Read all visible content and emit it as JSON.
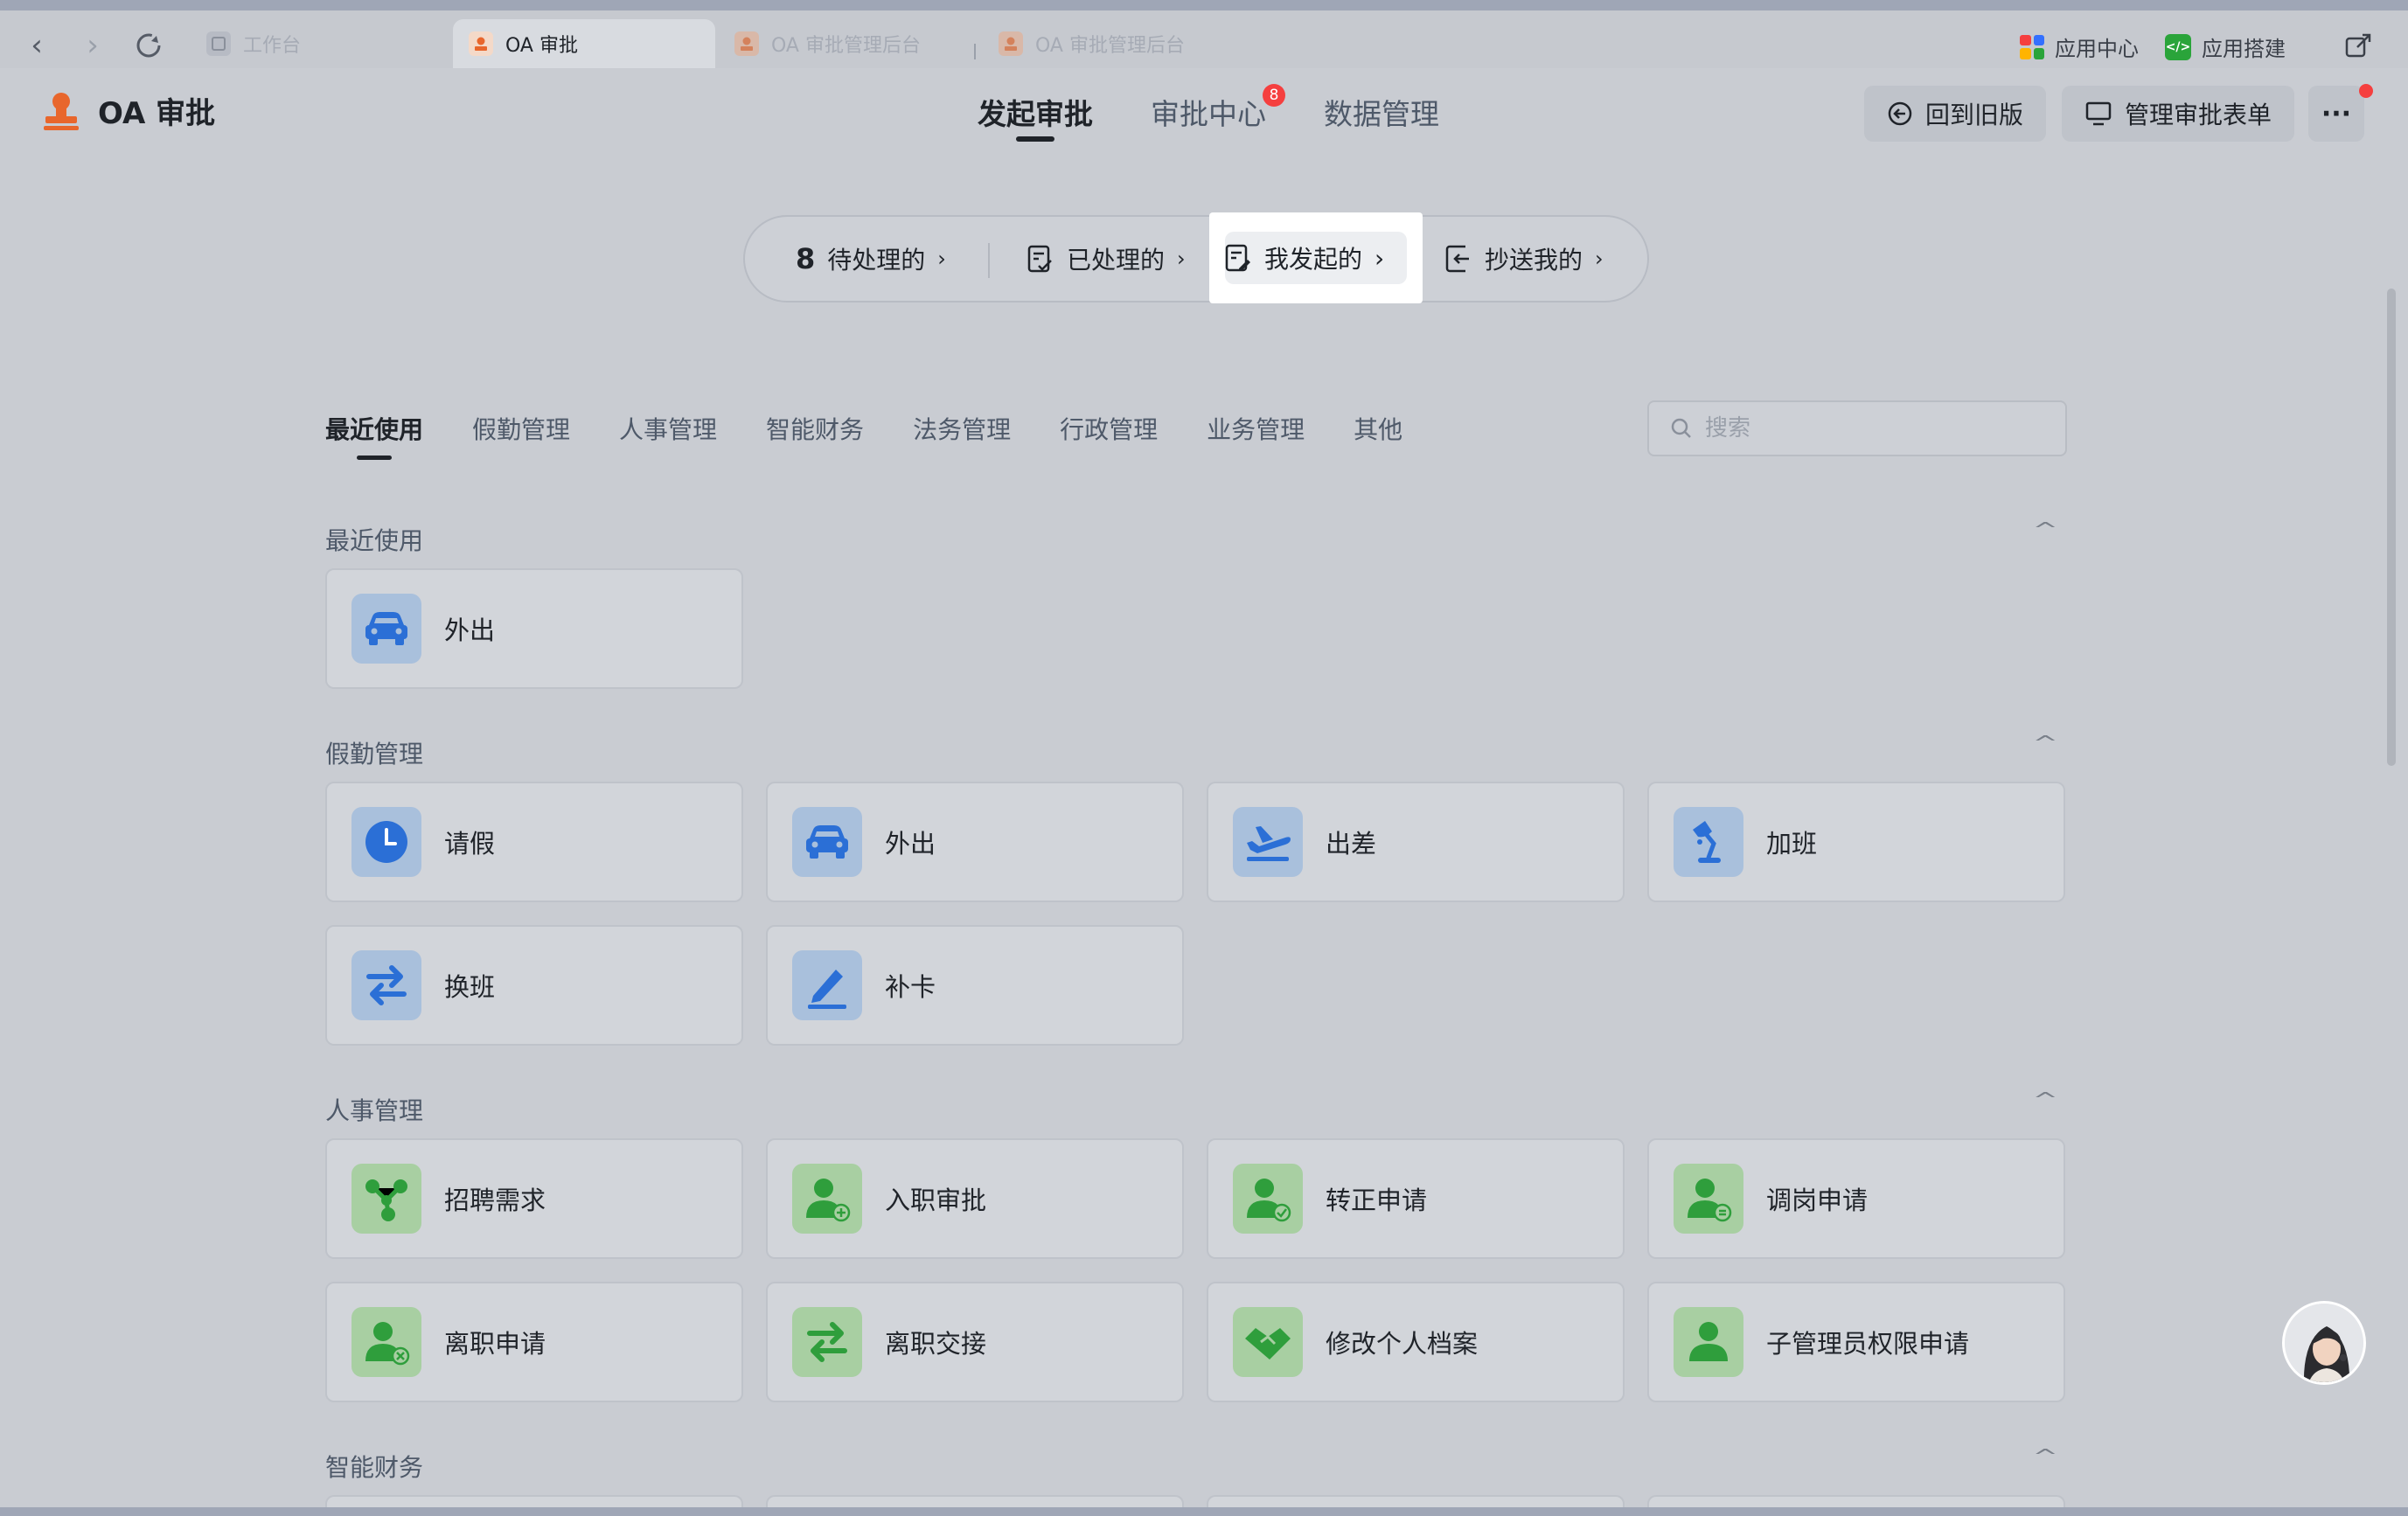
{
  "browser": {
    "tabs": [
      {
        "label": "工作台",
        "active": false
      },
      {
        "label": "OA 审批",
        "active": true
      },
      {
        "label": "OA 审批管理后台",
        "active": false
      },
      {
        "label": "OA 审批管理后台",
        "active": false
      }
    ],
    "app_center": "应用中心",
    "app_builder": "应用搭建"
  },
  "header": {
    "title": "OA 审批",
    "tabs": [
      {
        "label": "发起审批",
        "active": true
      },
      {
        "label": "审批中心",
        "badge": "8"
      },
      {
        "label": "数据管理"
      }
    ],
    "back_old_label": "回到旧版",
    "manage_forms_label": "管理审批表单",
    "more_label": "···"
  },
  "quick_filters": {
    "pending_count": "8",
    "pending_label": "待处理的",
    "processed_label": "已处理的",
    "initiated_label": "我发起的",
    "cc_label": "抄送我的",
    "chevron": "›"
  },
  "categories": [
    "最近使用",
    "假勤管理",
    "人事管理",
    "智能财务",
    "法务管理",
    "行政管理",
    "业务管理",
    "其他"
  ],
  "search": {
    "placeholder": "搜索"
  },
  "sections": {
    "recent": {
      "title": "最近使用",
      "items": [
        "外出"
      ]
    },
    "attendance": {
      "title": "假勤管理",
      "items": [
        "请假",
        "外出",
        "出差",
        "加班",
        "换班",
        "补卡"
      ]
    },
    "hr": {
      "title": "人事管理",
      "items": [
        "招聘需求",
        "入职审批",
        "转正申请",
        "调岗申请",
        "离职申请",
        "离职交接",
        "修改个人档案",
        "子管理员权限申请"
      ]
    },
    "finance": {
      "title": "智能财务"
    }
  },
  "colors": {
    "accent_blue": "#2b6fd6",
    "accent_green": "#2f9e3c",
    "badge_red": "#f53f3f",
    "brand_orange": "#e8662c"
  }
}
